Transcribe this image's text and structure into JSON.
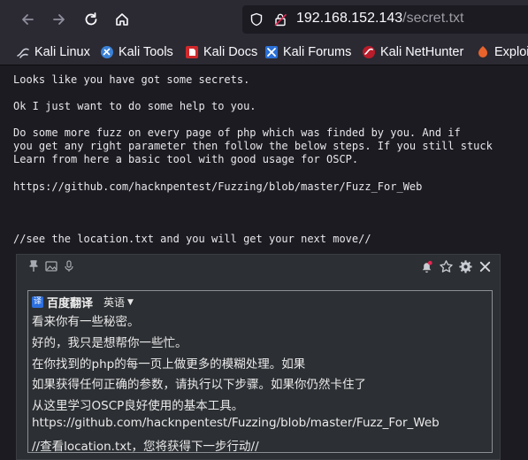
{
  "browser": {
    "url_host": "192.168.152.143",
    "url_path": "/secret.txt",
    "bookmarks": [
      {
        "label": "Kali Linux",
        "icon": "kali-dragon-icon"
      },
      {
        "label": "Kali Tools",
        "icon": "kali-tools-icon"
      },
      {
        "label": "Kali Docs",
        "icon": "kali-docs-icon"
      },
      {
        "label": "Kali Forums",
        "icon": "kali-forums-icon"
      },
      {
        "label": "Kali NetHunter",
        "icon": "kali-nethunter-icon"
      },
      {
        "label": "Exploi",
        "icon": "exploit-db-icon"
      }
    ]
  },
  "page": {
    "lines": [
      "Looks like you have got some secrets.",
      "Ok I just want to do some help to you.",
      "Do some more fuzz on every page of php which was finded by you. And if",
      "you get any right parameter then follow the below steps. If you still stuck",
      "Learn from here a basic tool with good usage for OSCP.",
      "https://github.com/hacknpentest/Fuzzing/blob/master/Fuzz_For_Web",
      "//see the location.txt and you will get your next move//"
    ]
  },
  "translate": {
    "brand": "百度翻译",
    "badge": "译",
    "language": "英语",
    "lines": [
      "看来你有一些秘密。",
      "好的，我只是想帮你一些忙。",
      "在你找到的php的每一页上做更多的模糊处理。如果",
      "如果获得任何正确的参数，请执行以下步骤。如果你仍然卡住了",
      "从这里学习OSCP良好使用的基本工具。",
      "https://github.com/hacknpentest/Fuzzing/blob/master/Fuzz_For_Web",
      "//查看location.txt，您将获得下一步行动//"
    ]
  },
  "colors": {
    "toolbar_bg": "#2b2a33",
    "page_bg": "#1c1b22",
    "text": "#e8e8ea",
    "popup_bg": "#2c2f33",
    "accent_red": "#e22850",
    "baidu_blue": "#2d6fe0"
  }
}
